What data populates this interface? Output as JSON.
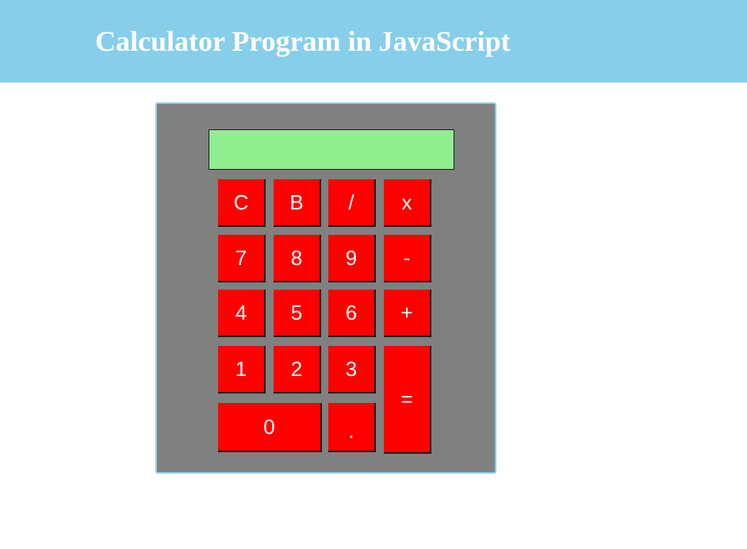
{
  "header": {
    "title": "Calculator Program in JavaScript"
  },
  "calculator": {
    "display_value": "",
    "keys": {
      "clear": "C",
      "back": "B",
      "divide": "/",
      "multiply": "x",
      "seven": "7",
      "eight": "8",
      "nine": "9",
      "minus": "-",
      "four": "4",
      "five": "5",
      "six": "6",
      "plus": "+",
      "one": "1",
      "two": "2",
      "three": "3",
      "equals": "=",
      "zero": "0",
      "decimal": "."
    }
  },
  "colors": {
    "header_bg": "#87ceeb",
    "calculator_bg": "#808080",
    "display_bg": "#90ee90",
    "key_bg": "#ff0000",
    "key_text": "#ffffff"
  }
}
